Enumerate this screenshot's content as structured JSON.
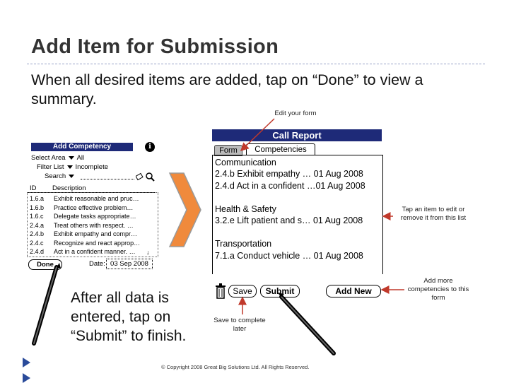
{
  "slide": {
    "title": "Add Item for Submission",
    "intro": "When all desired items are added, tap on “Done” to view a summary.",
    "after_text": "After all data is entered, tap on “Submit” to finish.",
    "copyright": "© Copyright 2008 Great Big Solutions Ltd. All Rights Reserved."
  },
  "annotations": {
    "edit_form": "Edit your form",
    "tap_item": "Tap an item to edit or remove it from this list",
    "add_more": "Add more competencies to this form",
    "save_later": "Save to complete later"
  },
  "add_competency": {
    "title": "Add Competency",
    "info_glyph": "i",
    "select_area_label": "Select Area",
    "select_area_value": "All",
    "filter_list_label": "Filter List",
    "filter_list_value": "Incomplete",
    "search_label": "Search",
    "col_id": "ID",
    "col_desc": "Description",
    "rows": [
      {
        "id": "1.6.a",
        "desc": "Exhibit reasonable and pruc…"
      },
      {
        "id": "1.6.b",
        "desc": "Practice effective problem…"
      },
      {
        "id": "1.6.c",
        "desc": "Delegate tasks appropriate…"
      },
      {
        "id": "2.4.a",
        "desc": "Treat others with respect. …"
      },
      {
        "id": "2.4.b",
        "desc": "Exhibit empathy and compr…"
      },
      {
        "id": "2.4.c",
        "desc": "Recognize and react approp…"
      },
      {
        "id": "2.4.d",
        "desc": "Act in a confident manner. …"
      }
    ],
    "done_label": "Done",
    "date_label": "Date:",
    "date_value": "03 Sep 2008"
  },
  "call_report": {
    "title": "Call Report",
    "tab_form": "Form",
    "tab_competencies": "Competencies",
    "lines": [
      "Communication",
      "2.4.b   Exhibit empathy … 01 Aug 2008",
      "2.4.d   Act in a confident …01 Aug 2008",
      "",
      "Health & Safety",
      "3.2.e   Lift patient and s… 01 Aug 2008",
      "",
      "Transportation",
      "7.1.a   Conduct vehicle …   01 Aug 2008"
    ],
    "save_label": "Save",
    "submit_label": "Submit",
    "add_new_label": "Add New"
  },
  "colors": {
    "title_bar": "#1e2a78",
    "arrow_red": "#c0392b",
    "chevron": "#f08a3c",
    "bullet": "#2a4b9a"
  }
}
